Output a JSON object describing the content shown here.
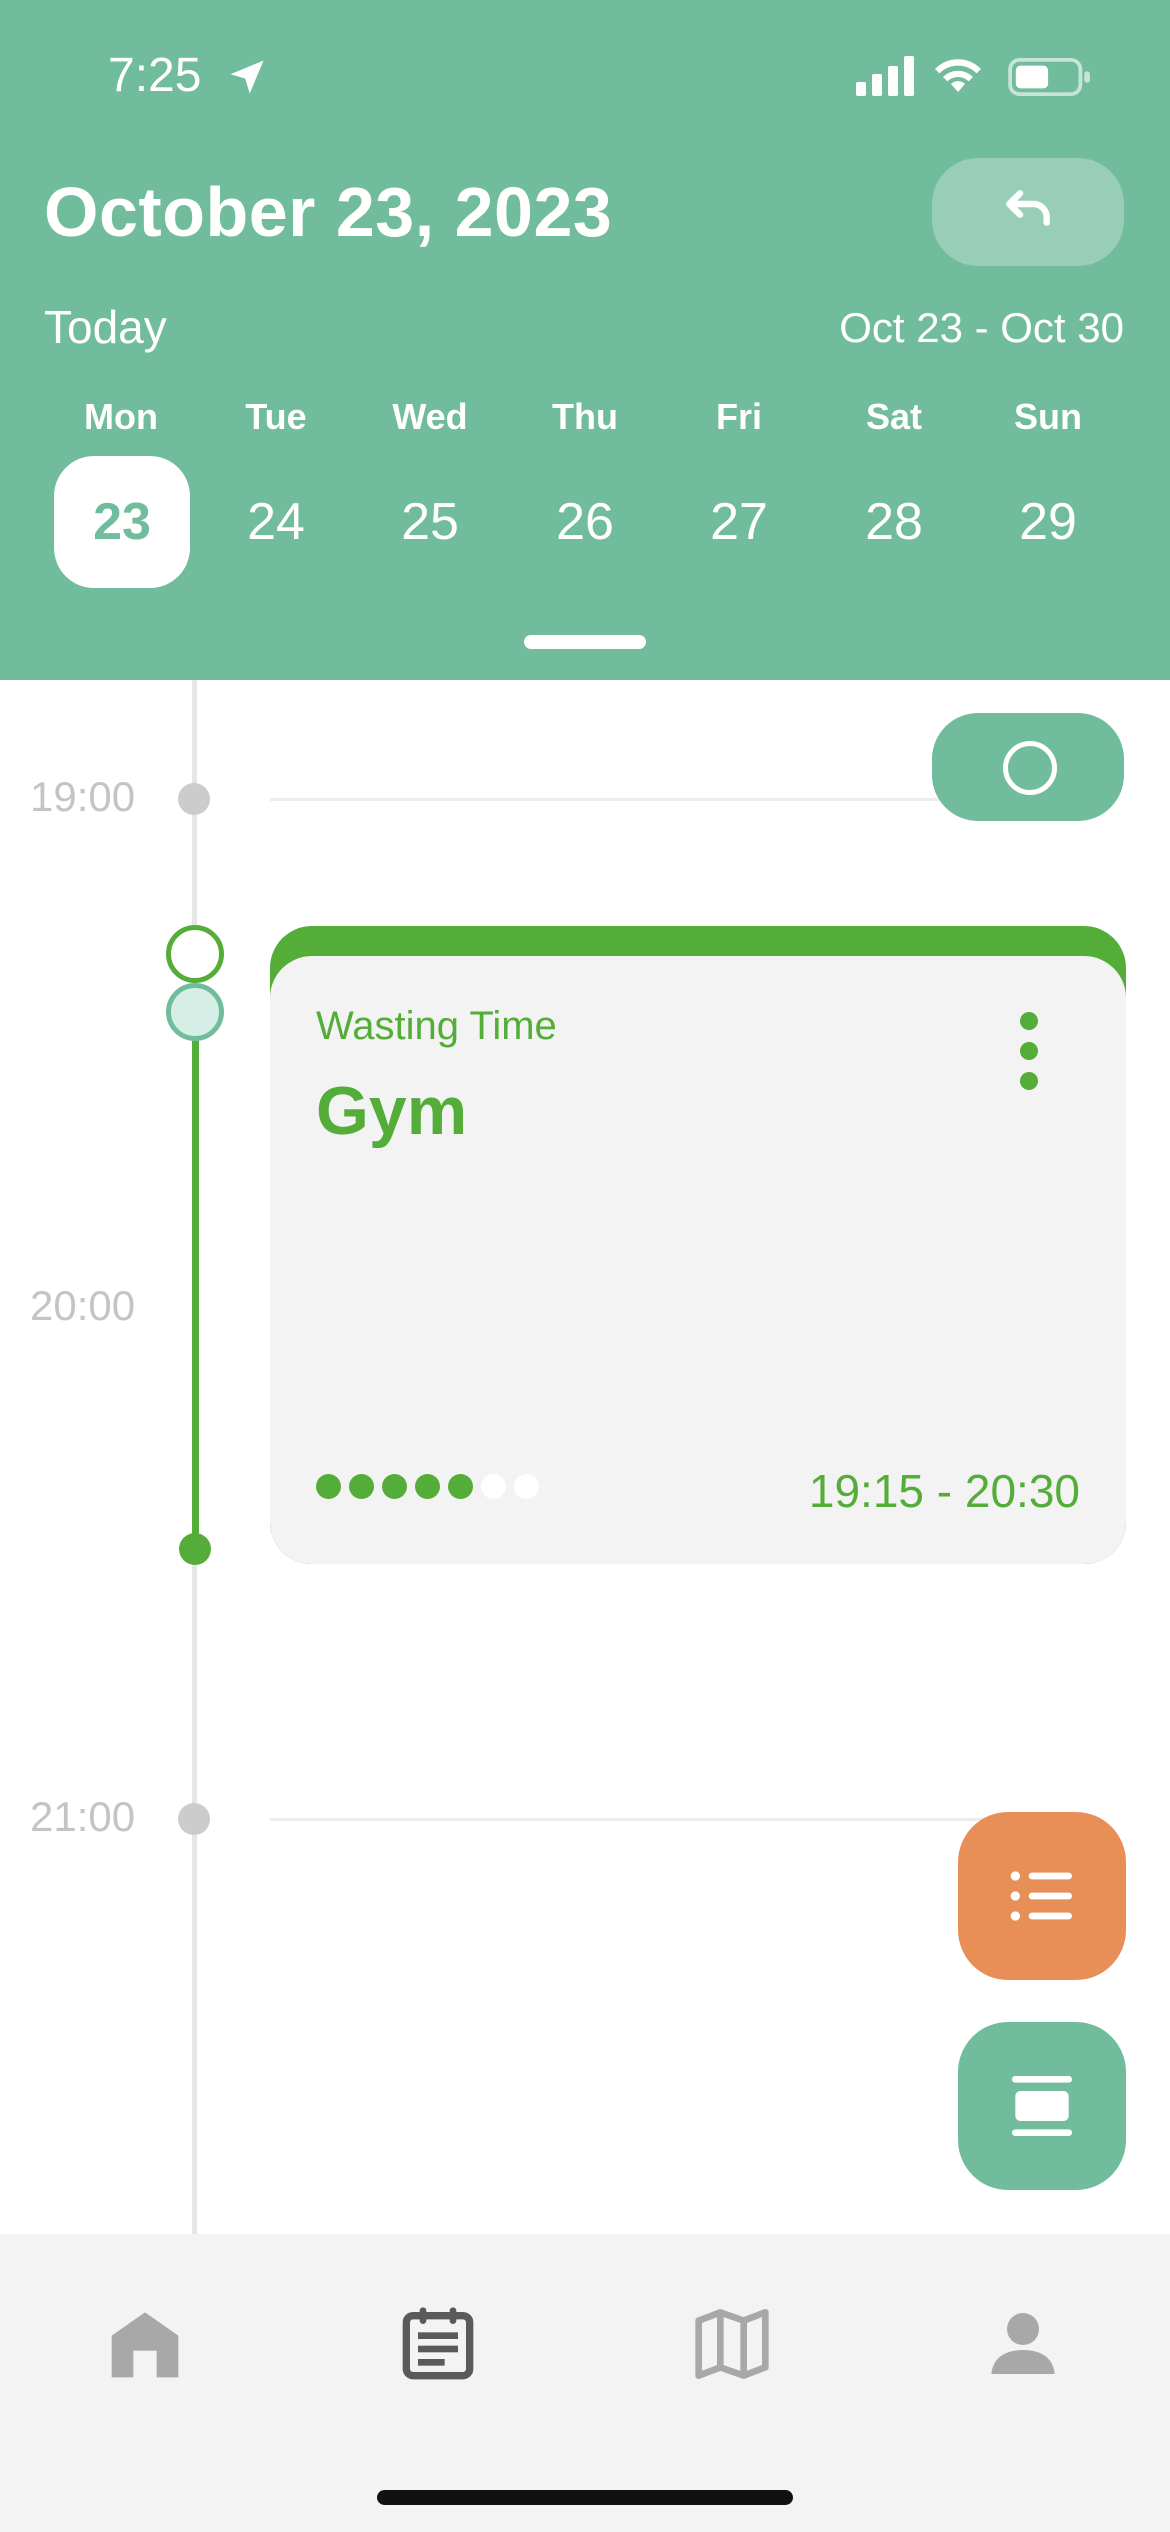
{
  "status_bar": {
    "time": "7:25"
  },
  "header": {
    "date_title": "October 23, 2023",
    "today_label": "Today",
    "week_range": "Oct 23 - Oct 30",
    "days": [
      {
        "name": "Mon",
        "num": "23",
        "selected": true
      },
      {
        "name": "Tue",
        "num": "24"
      },
      {
        "name": "Wed",
        "num": "25"
      },
      {
        "name": "Thu",
        "num": "26"
      },
      {
        "name": "Fri",
        "num": "27"
      },
      {
        "name": "Sat",
        "num": "28"
      },
      {
        "name": "Sun",
        "num": "29"
      }
    ]
  },
  "timeline": {
    "hours": [
      "19:00",
      "20:00",
      "21:00"
    ]
  },
  "event": {
    "category": "Wasting Time",
    "title": "Gym",
    "time_range": "19:15 - 20:30",
    "rating": {
      "filled": 5,
      "total": 7
    },
    "color": "#55ad39"
  },
  "colors": {
    "accent": "#71bc9c",
    "event_green": "#55ad39",
    "list_fab": "#e88f58",
    "tabbar": "#f3f3f3"
  },
  "tabs": [
    {
      "icon": "home-icon",
      "active": false
    },
    {
      "icon": "calendar-icon",
      "active": true
    },
    {
      "icon": "map-icon",
      "active": false
    },
    {
      "icon": "profile-icon",
      "active": false
    }
  ]
}
